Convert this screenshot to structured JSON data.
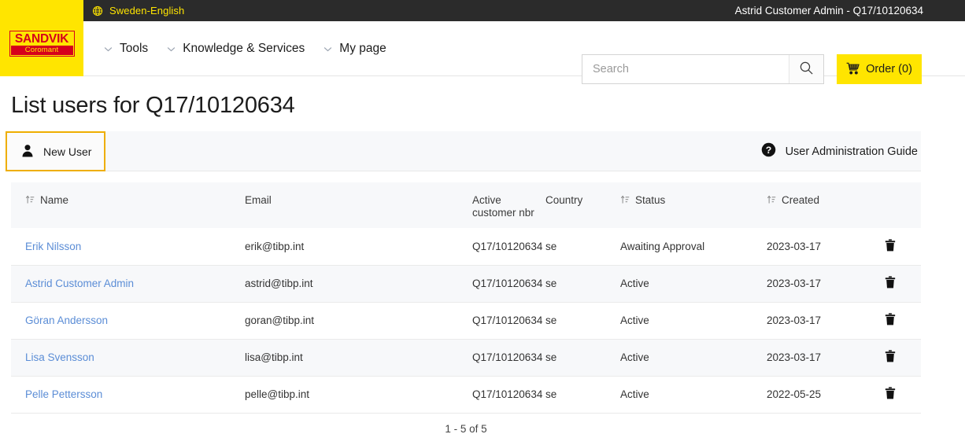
{
  "topbar": {
    "language": "Sweden-English",
    "globe_icon": "globe-icon",
    "account": "Astrid Customer Admin - Q17/10120634"
  },
  "brand": {
    "logo_top": "SANDVIK",
    "logo_bottom": "Coromant",
    "logo_bg": "#ffe500",
    "logo_red": "#d6001c"
  },
  "nav": {
    "items": [
      {
        "label": "Tools",
        "icon": "chevron-down-icon"
      },
      {
        "label": "Knowledge & Services",
        "icon": "chevron-down-icon"
      },
      {
        "label": "My page",
        "icon": "chevron-down-icon"
      }
    ]
  },
  "search": {
    "placeholder": "Search",
    "value": "",
    "icon": "search-icon"
  },
  "order": {
    "label": "Order (0)",
    "icon": "cart-icon",
    "bg": "#ffe500"
  },
  "page": {
    "title": "List users for Q17/10120634"
  },
  "actionbar": {
    "new_user_label": "New User",
    "new_user_icon": "person-icon",
    "new_user_border": "#eeae00",
    "guide_label": "User Administration Guide",
    "guide_icon": "help-circle-icon"
  },
  "table": {
    "columns": [
      {
        "label": "Name",
        "sortable": true,
        "icon": "sort-ascending-icon"
      },
      {
        "label": "Email",
        "sortable": false
      },
      {
        "label": "Active customer nbr",
        "sortable": false
      },
      {
        "label": "Country",
        "sortable": false
      },
      {
        "label": "Status",
        "sortable": true,
        "icon": "sort-ascending-icon"
      },
      {
        "label": "Created",
        "sortable": true,
        "icon": "sort-ascending-icon"
      }
    ],
    "rows": [
      {
        "name": "Erik Nilsson",
        "email": "erik@tibp.int",
        "active_customer_nbr": "Q17/10120634",
        "country": "se",
        "status": "Awaiting Approval",
        "created": "2023-03-17",
        "delete_icon": "trash-icon"
      },
      {
        "name": "Astrid Customer Admin",
        "email": "astrid@tibp.int",
        "active_customer_nbr": "Q17/10120634",
        "country": "se",
        "status": "Active",
        "created": "2023-03-17",
        "delete_icon": "trash-icon"
      },
      {
        "name": "Göran Andersson",
        "email": "goran@tibp.int",
        "active_customer_nbr": "Q17/10120634",
        "country": "se",
        "status": "Active",
        "created": "2023-03-17",
        "delete_icon": "trash-icon"
      },
      {
        "name": "Lisa Svensson",
        "email": "lisa@tibp.int",
        "active_customer_nbr": "Q17/10120634",
        "country": "se",
        "status": "Active",
        "created": "2023-03-17",
        "delete_icon": "trash-icon"
      },
      {
        "name": "Pelle Pettersson",
        "email": "pelle@tibp.int",
        "active_customer_nbr": "Q17/10120634",
        "country": "se",
        "status": "Active",
        "created": "2022-05-25",
        "delete_icon": "trash-icon"
      }
    ]
  },
  "pagination": {
    "summary": "1 - 5 of 5"
  }
}
